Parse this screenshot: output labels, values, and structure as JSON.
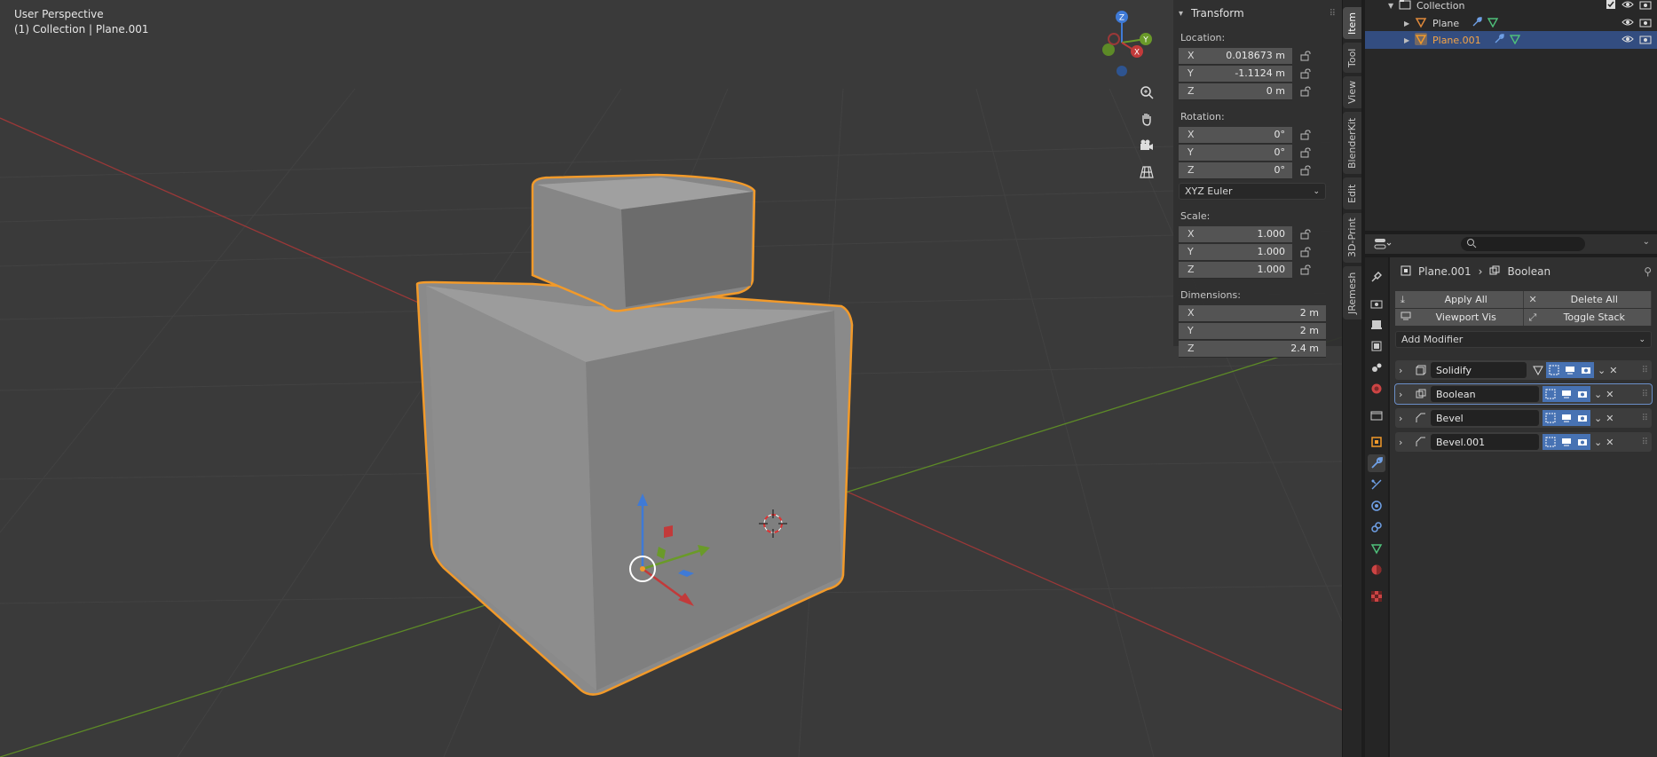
{
  "viewport": {
    "perspective_label": "User Perspective",
    "context_label": "(1) Collection | Plane.001"
  },
  "gizmo": {
    "axes": [
      "X",
      "Y",
      "Z"
    ]
  },
  "transform_panel": {
    "title": "Transform",
    "location_label": "Location:",
    "location": [
      {
        "axis": "X",
        "value": "0.018673 m"
      },
      {
        "axis": "Y",
        "value": "-1.1124 m"
      },
      {
        "axis": "Z",
        "value": "0 m"
      }
    ],
    "rotation_label": "Rotation:",
    "rotation": [
      {
        "axis": "X",
        "value": "0°"
      },
      {
        "axis": "Y",
        "value": "0°"
      },
      {
        "axis": "Z",
        "value": "0°"
      }
    ],
    "rotation_mode": "XYZ Euler",
    "scale_label": "Scale:",
    "scale": [
      {
        "axis": "X",
        "value": "1.000"
      },
      {
        "axis": "Y",
        "value": "1.000"
      },
      {
        "axis": "Z",
        "value": "1.000"
      }
    ],
    "dimensions_label": "Dimensions:",
    "dimensions": [
      {
        "axis": "X",
        "value": "2 m"
      },
      {
        "axis": "Y",
        "value": "2 m"
      },
      {
        "axis": "Z",
        "value": "2.4 m"
      }
    ]
  },
  "sidebar_tabs": [
    "Item",
    "Tool",
    "View",
    "BlenderKit",
    "Edit",
    "3D-Print",
    "JRemesh"
  ],
  "outliner": {
    "collection": "Collection",
    "items": [
      {
        "name": "Plane",
        "selected": false
      },
      {
        "name": "Plane.001",
        "selected": true
      }
    ]
  },
  "properties": {
    "object_name": "Plane.001",
    "modifier_name": "Boolean",
    "apply_all": "Apply All",
    "delete_all": "Delete All",
    "viewport_vis": "Viewport Vis",
    "toggle_stack": "Toggle Stack",
    "add_modifier": "Add Modifier",
    "modifiers": [
      {
        "name": "Solidify",
        "active": false
      },
      {
        "name": "Boolean",
        "active": true
      },
      {
        "name": "Bevel",
        "active": false
      },
      {
        "name": "Bevel.001",
        "active": false
      }
    ]
  },
  "colors": {
    "accent": "#4772b3",
    "selection_outline": "#f29a2a",
    "axis_x": "#b43c3c",
    "axis_y": "#6a9a29",
    "axis_z": "#3f7ad6"
  }
}
